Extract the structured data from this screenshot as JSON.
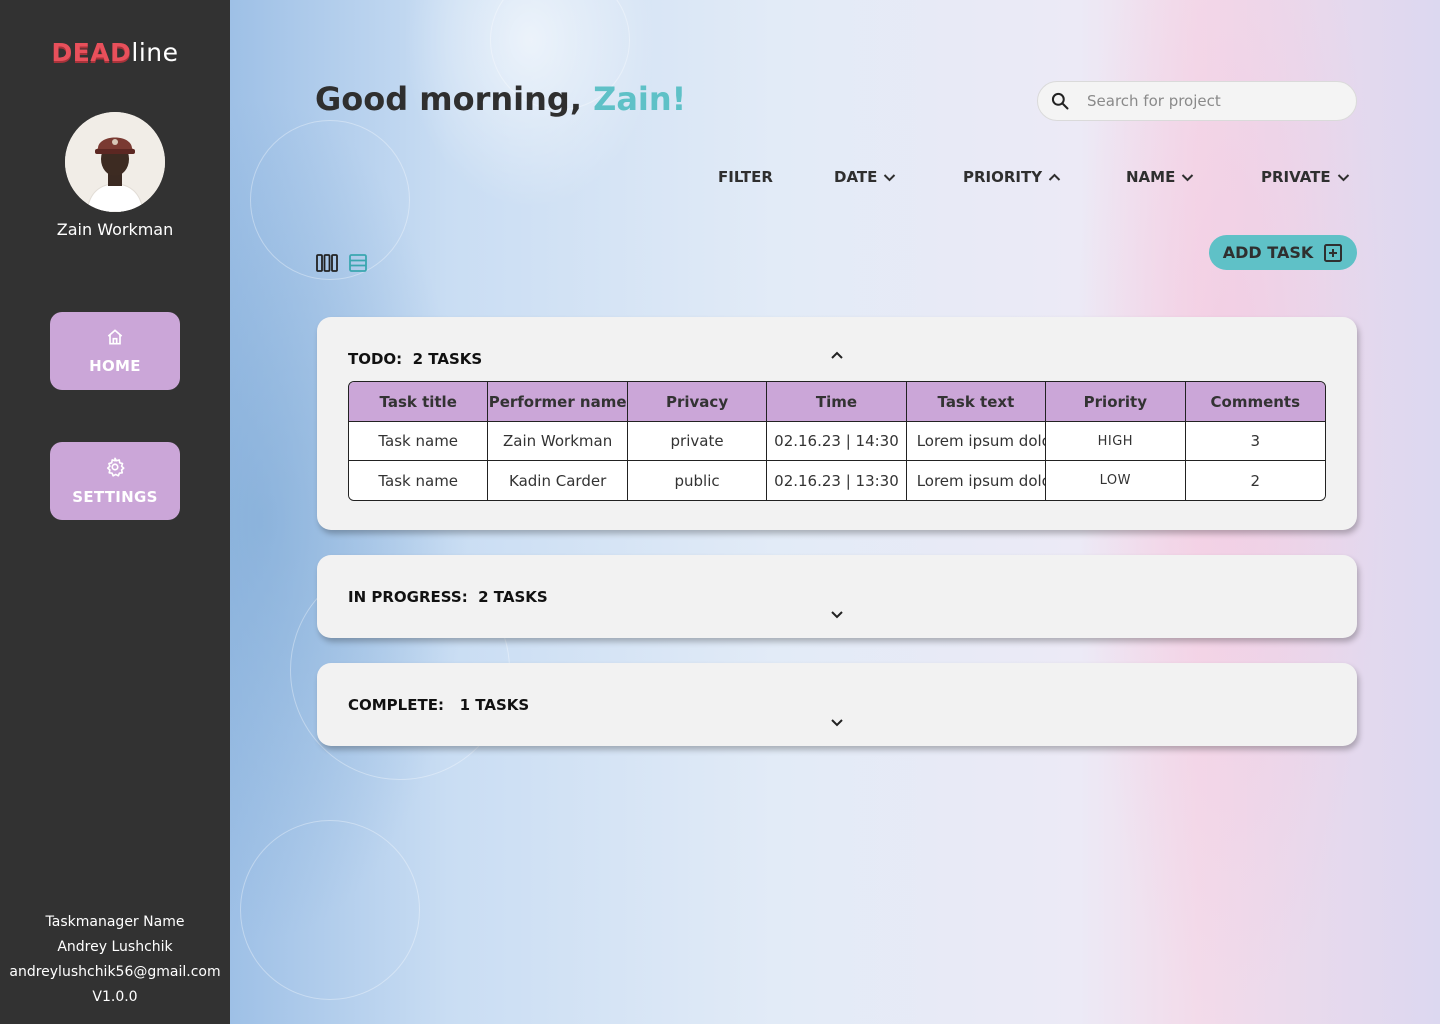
{
  "brand": {
    "logo_strong": "DEAD",
    "logo_light": "line"
  },
  "user": {
    "name": "Zain Workman"
  },
  "nav": [
    {
      "label": "HOME",
      "icon": "home-icon"
    },
    {
      "label": "SETTINGS",
      "icon": "gear-icon"
    }
  ],
  "footer": {
    "app_name": "Taskmanager Name",
    "author": "Andrey Lushchik",
    "email": "andreylushchik56@gmail.com",
    "version": "V1.0.0"
  },
  "greeting": {
    "prefix": "Good morning, ",
    "name": "Zain!"
  },
  "search": {
    "placeholder": "Search for project",
    "value": ""
  },
  "filters": [
    {
      "label": "FILTER",
      "chevron": ""
    },
    {
      "label": "DATE",
      "chevron": "down"
    },
    {
      "label": "PRIORITY",
      "chevron": "up"
    },
    {
      "label": "NAME",
      "chevron": "down"
    },
    {
      "label": "PRIVATE",
      "chevron": "down"
    }
  ],
  "add_task_label": "ADD TASK",
  "groups": {
    "todo": {
      "title": "TODO:  2 TASKS",
      "expanded": true
    },
    "in_progress": {
      "title": "IN PROGRESS:  2 TASKS",
      "expanded": false
    },
    "complete": {
      "title": "COMPLETE:   1 TASKS",
      "expanded": false
    }
  },
  "table": {
    "headers": [
      "Task title",
      "Performer name",
      "Privacy",
      "Time",
      "Task text",
      "Priority",
      "Comments"
    ],
    "rows": [
      [
        "Task name",
        "Zain Workman",
        "private",
        "02.16.23 | 14:30",
        "Lorem ipsum dolor sit amet",
        "HIGH",
        "3"
      ],
      [
        "Task name",
        "Kadin Carder",
        "public",
        "02.16.23 | 13:30",
        "Lorem ipsum dolor sit amet",
        "LOW",
        "2"
      ]
    ]
  },
  "colors": {
    "sidebar": "#323232",
    "brand_red": "#e8505b",
    "accent_teal": "#5fc1c7",
    "nav_purple": "#cba6d8",
    "card_bg": "#f2f2f2"
  }
}
